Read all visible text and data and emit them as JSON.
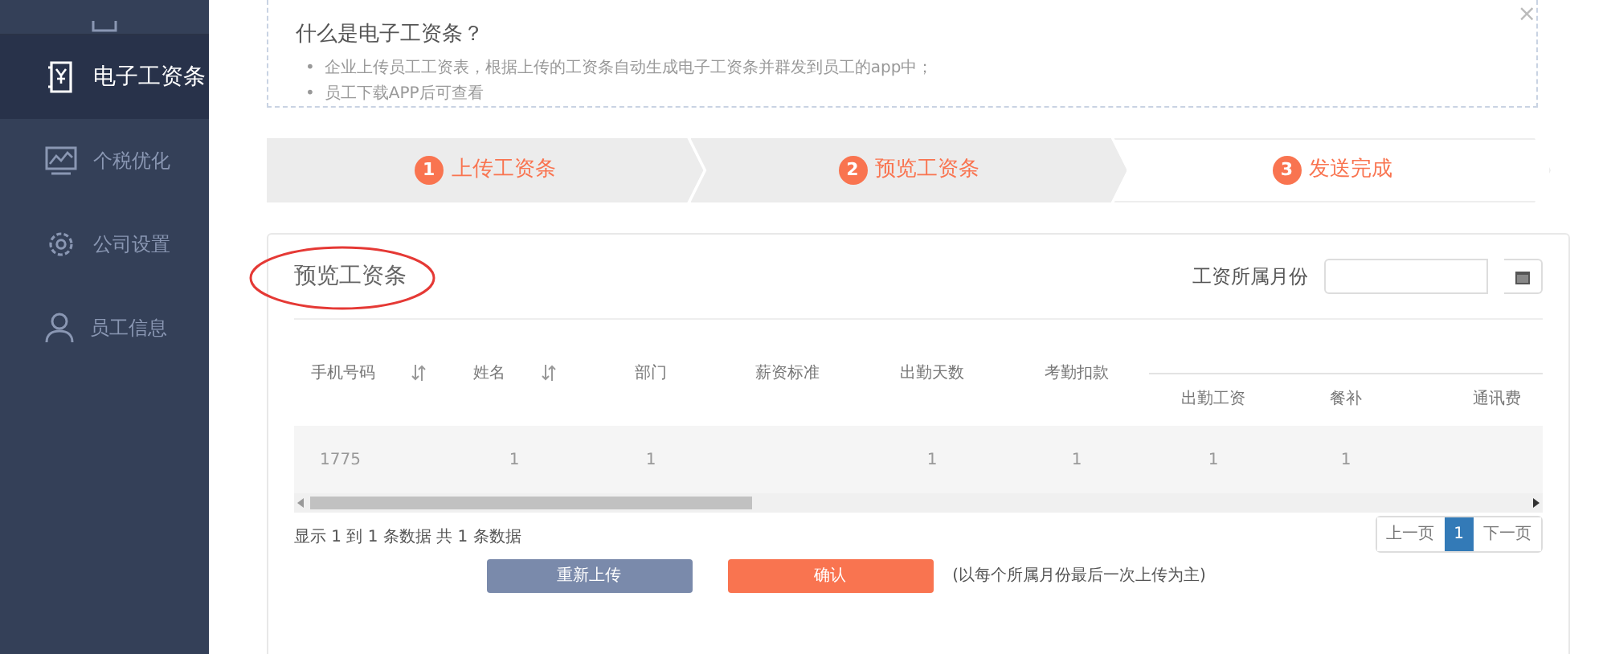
{
  "sidebar": {
    "items": [
      {
        "label": "电子工资条",
        "selected": true
      },
      {
        "label": "个税优化",
        "selected": false
      },
      {
        "label": "公司设置",
        "selected": false
      },
      {
        "label": "员工信息",
        "selected": false
      }
    ]
  },
  "notice": {
    "title": "什么是电子工资条？",
    "items": [
      {
        "marker": "•",
        "text": "企业上传员工工资表，根据上传的工资条自动生成电子工资条并群发到员工的app中；"
      },
      {
        "marker": "•",
        "text": "员工下载APP后可查看"
      }
    ],
    "close": "×"
  },
  "steps": [
    {
      "number": "1",
      "label": "上传工资条",
      "reached": true
    },
    {
      "number": "2",
      "label": "预览工资条",
      "reached": true
    },
    {
      "number": "3",
      "label": "发送完成",
      "reached": false
    }
  ],
  "preview": {
    "title": "预览工资条",
    "month_label": "工资所属月份",
    "table": {
      "columns": [
        {
          "label": "手机号码",
          "sortable": true
        },
        {
          "label": "姓名",
          "sortable": true
        },
        {
          "label": "部门",
          "sortable": false
        },
        {
          "label": "薪资标准",
          "sortable": false
        },
        {
          "label": "出勤天数",
          "sortable": false
        },
        {
          "label": "考勤扣款",
          "sortable": false
        }
      ],
      "group_columns": [
        "出勤工资",
        "餐补",
        "通讯费"
      ],
      "rows": [
        [
          "1775",
          "1",
          "1",
          "",
          "1",
          "1",
          "1",
          "1",
          ""
        ]
      ]
    },
    "summary": "显示 1 到 1 条数据 共 1 条数据",
    "pagination": {
      "prev": "上一页",
      "pages": [
        {
          "label": "1",
          "selected": true
        }
      ],
      "next": "下一页"
    },
    "buttons": [
      {
        "label": "重新上传",
        "kind": "secondary"
      },
      {
        "label": "确认",
        "kind": "primary"
      }
    ],
    "note": "(以每个所属月份最后一次上传为主)"
  }
}
